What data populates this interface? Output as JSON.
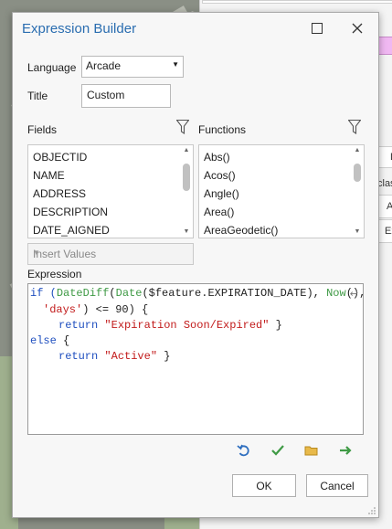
{
  "dialog": {
    "title": "Expression Builder",
    "language_label": "Language",
    "language_value": "Arcade",
    "title_label": "Title",
    "title_value": "Custom",
    "fields_label": "Fields",
    "functions_label": "Functions",
    "fields": [
      "OBJECTID",
      "NAME",
      "ADDRESS",
      "DESCRIPTION",
      "DATE_AIGNED"
    ],
    "functions": [
      "Abs()",
      "Acos()",
      "Angle()",
      "Area()",
      "AreaGeodetic()"
    ],
    "insert_values_placeholder": "Insert Values",
    "expression_label": "Expression",
    "code": {
      "l1_if": "if (",
      "l1_datediff": "DateDiff",
      "l1_p1": "(",
      "l1_date": "Date",
      "l1_p2": "($feature.EXPIRATION_DATE), ",
      "l1_now": "Now",
      "l1_p3": "(),",
      "l2_days": "'days'",
      "l2_rest": ") <= 90) {",
      "l3_return": "return ",
      "l3_str": "\"Expiration Soon/Expired\"",
      "l3_brace": " }",
      "l4_else": "else",
      "l4_brace": " {",
      "l5_return": "return ",
      "l5_str": "\"Active\"",
      "l5_brace": " }"
    },
    "ok_label": "OK",
    "cancel_label": "Cancel"
  },
  "background": {
    "frag1": "L",
    "frag2": "clas",
    "frag3": "A",
    "frag4": "Ex"
  },
  "colors": {
    "title": "#2a6db0",
    "keyword": "#1f4fbf",
    "function": "#3f9a45",
    "string": "#c21b1b"
  }
}
